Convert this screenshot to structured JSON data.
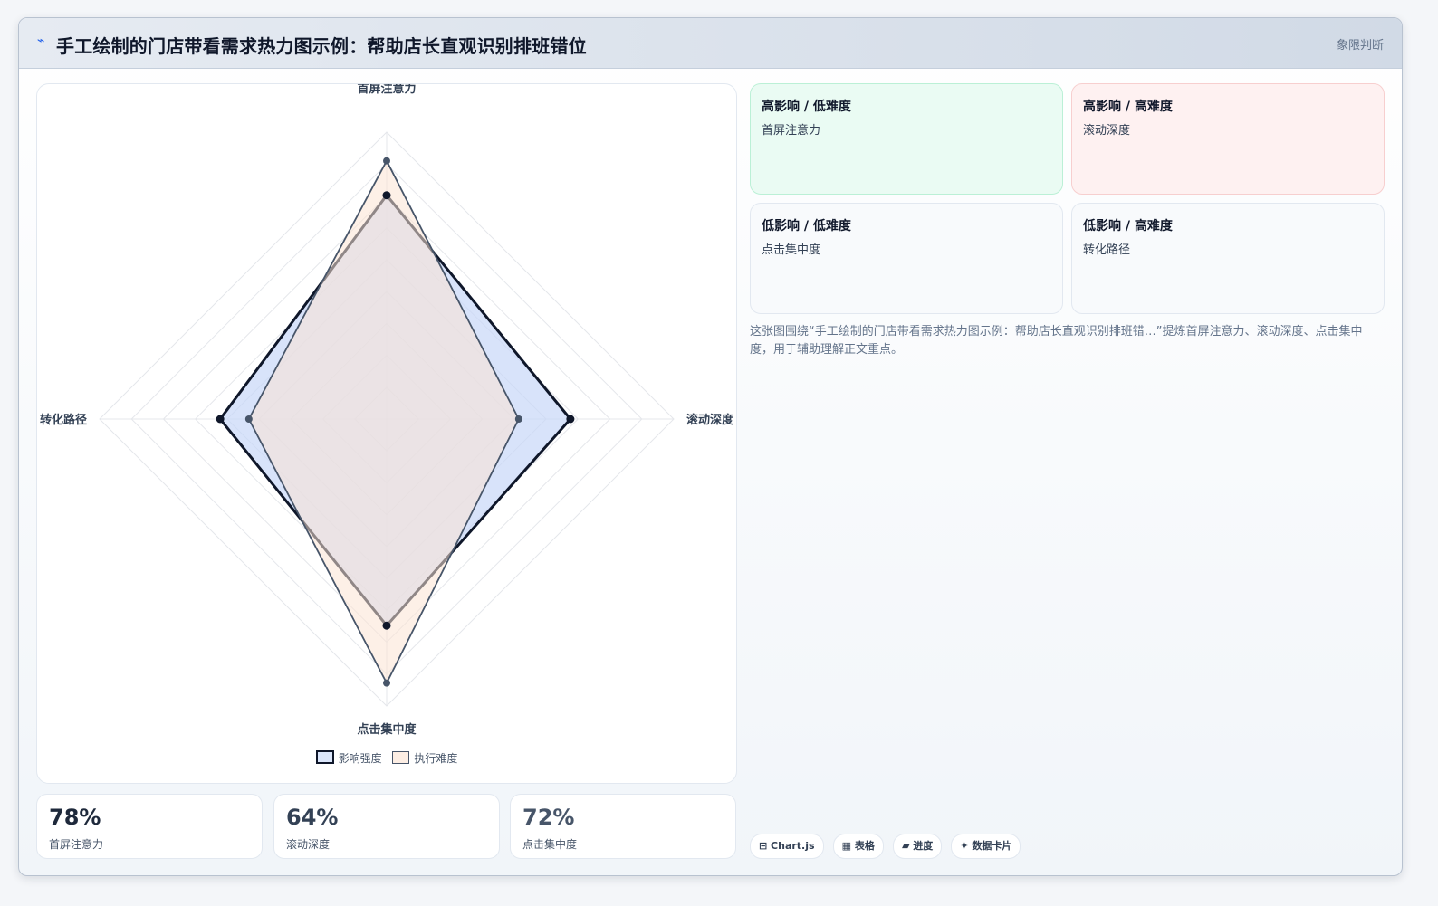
{
  "header": {
    "title": "手工绘制的门店带看需求热力图示例：帮助店长直观识别排班错位",
    "tag": "象限判断",
    "icon": "chart-line-icon"
  },
  "chart_data": {
    "type": "radar",
    "axes": [
      "首屏注意力",
      "滚动深度",
      "点击集中度",
      "转化路径"
    ],
    "rlim": [
      0,
      100
    ],
    "series": [
      {
        "name": "影响强度",
        "values": [
          78,
          64,
          72,
          58
        ],
        "fill": "#c7d7f8",
        "stroke": "#0f172a"
      },
      {
        "name": "执行难度",
        "values": [
          90,
          46,
          92,
          48
        ],
        "fill": "#fbe3d3",
        "stroke": "#475569"
      }
    ],
    "legend_position": "bottom",
    "grid": true
  },
  "stats": [
    {
      "value": "78%",
      "label": "首屏注意力",
      "color": "#1e293b"
    },
    {
      "value": "64%",
      "label": "滚动深度",
      "color": "#334155"
    },
    {
      "value": "72%",
      "label": "点击集中度",
      "color": "#475569"
    }
  ],
  "quadrants": [
    {
      "title": "高影响 / 低难度",
      "item": "首屏注意力",
      "bg": "#eafbf3",
      "border": "#bbf0d6"
    },
    {
      "title": "高影响 / 高难度",
      "item": "滚动深度",
      "bg": "#fef1f1",
      "border": "#f7cfcf"
    },
    {
      "title": "低影响 / 低难度",
      "item": "点击集中度",
      "bg": "#f8fafc",
      "border": "#e2e8f0"
    },
    {
      "title": "低影响 / 高难度",
      "item": "转化路径",
      "bg": "#f8fafc",
      "border": "#e2e8f0"
    }
  ],
  "note": "这张图围绕“手工绘制的门店带看需求热力图示例：帮助店长直观识别排班错…”提炼首屏注意力、滚动深度、点击集中度，用于辅助理解正文重点。",
  "chips": [
    "⊟ Chart.js",
    "▦ 表格",
    "▰ 进度",
    "✦ 数据卡片"
  ]
}
